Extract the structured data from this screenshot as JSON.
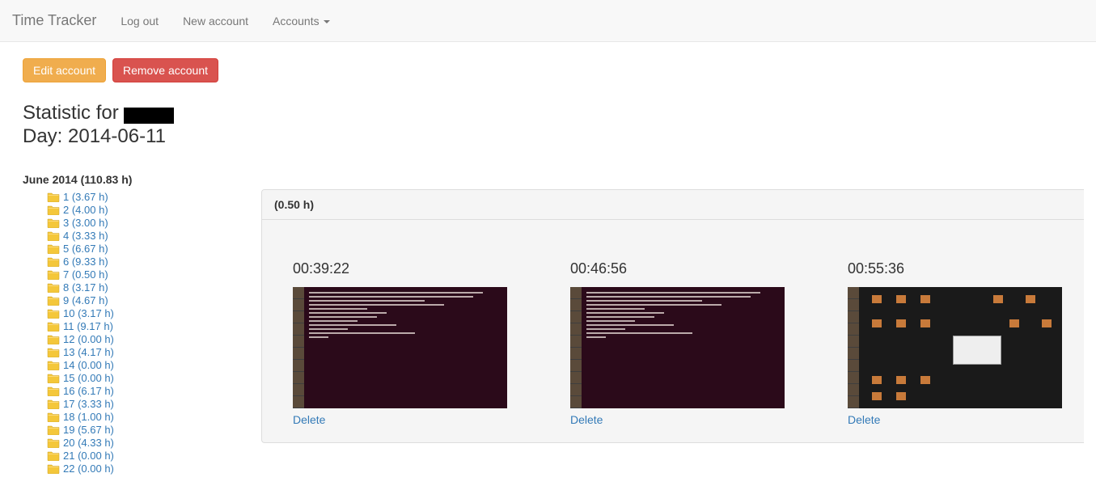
{
  "navbar": {
    "brand": "Time Tracker",
    "links": {
      "logout": "Log out",
      "new_account": "New account",
      "accounts": "Accounts"
    }
  },
  "actions": {
    "edit": "Edit account",
    "remove": "Remove account"
  },
  "heading": {
    "stat_prefix": "Statistic for ",
    "day_prefix": "Day: ",
    "day": "2014-06-11"
  },
  "sidebar": {
    "month_label": "June 2014 (110.83 h)",
    "days": [
      {
        "label": "1 (3.67 h)"
      },
      {
        "label": "2 (4.00 h)"
      },
      {
        "label": "3 (3.00 h)"
      },
      {
        "label": "4 (3.33 h)"
      },
      {
        "label": "5 (6.67 h)"
      },
      {
        "label": "6 (9.33 h)"
      },
      {
        "label": "7 (0.50 h)"
      },
      {
        "label": "8 (3.17 h)"
      },
      {
        "label": "9 (4.67 h)"
      },
      {
        "label": "10 (3.17 h)"
      },
      {
        "label": "11 (9.17 h)"
      },
      {
        "label": "12 (0.00 h)"
      },
      {
        "label": "13 (4.17 h)"
      },
      {
        "label": "14 (0.00 h)"
      },
      {
        "label": "15 (0.00 h)"
      },
      {
        "label": "16 (6.17 h)"
      },
      {
        "label": "17 (3.33 h)"
      },
      {
        "label": "18 (1.00 h)"
      },
      {
        "label": "19 (5.67 h)"
      },
      {
        "label": "20 (4.33 h)"
      },
      {
        "label": "21 (0.00 h)"
      },
      {
        "label": "22 (0.00 h)"
      }
    ]
  },
  "panel": {
    "header": "(0.50 h)",
    "shots": [
      {
        "time": "00:39:22",
        "delete": "Delete",
        "kind": "terminal"
      },
      {
        "time": "00:46:56",
        "delete": "Delete",
        "kind": "terminal"
      },
      {
        "time": "00:55:36",
        "delete": "Delete",
        "kind": "desktop"
      }
    ]
  }
}
